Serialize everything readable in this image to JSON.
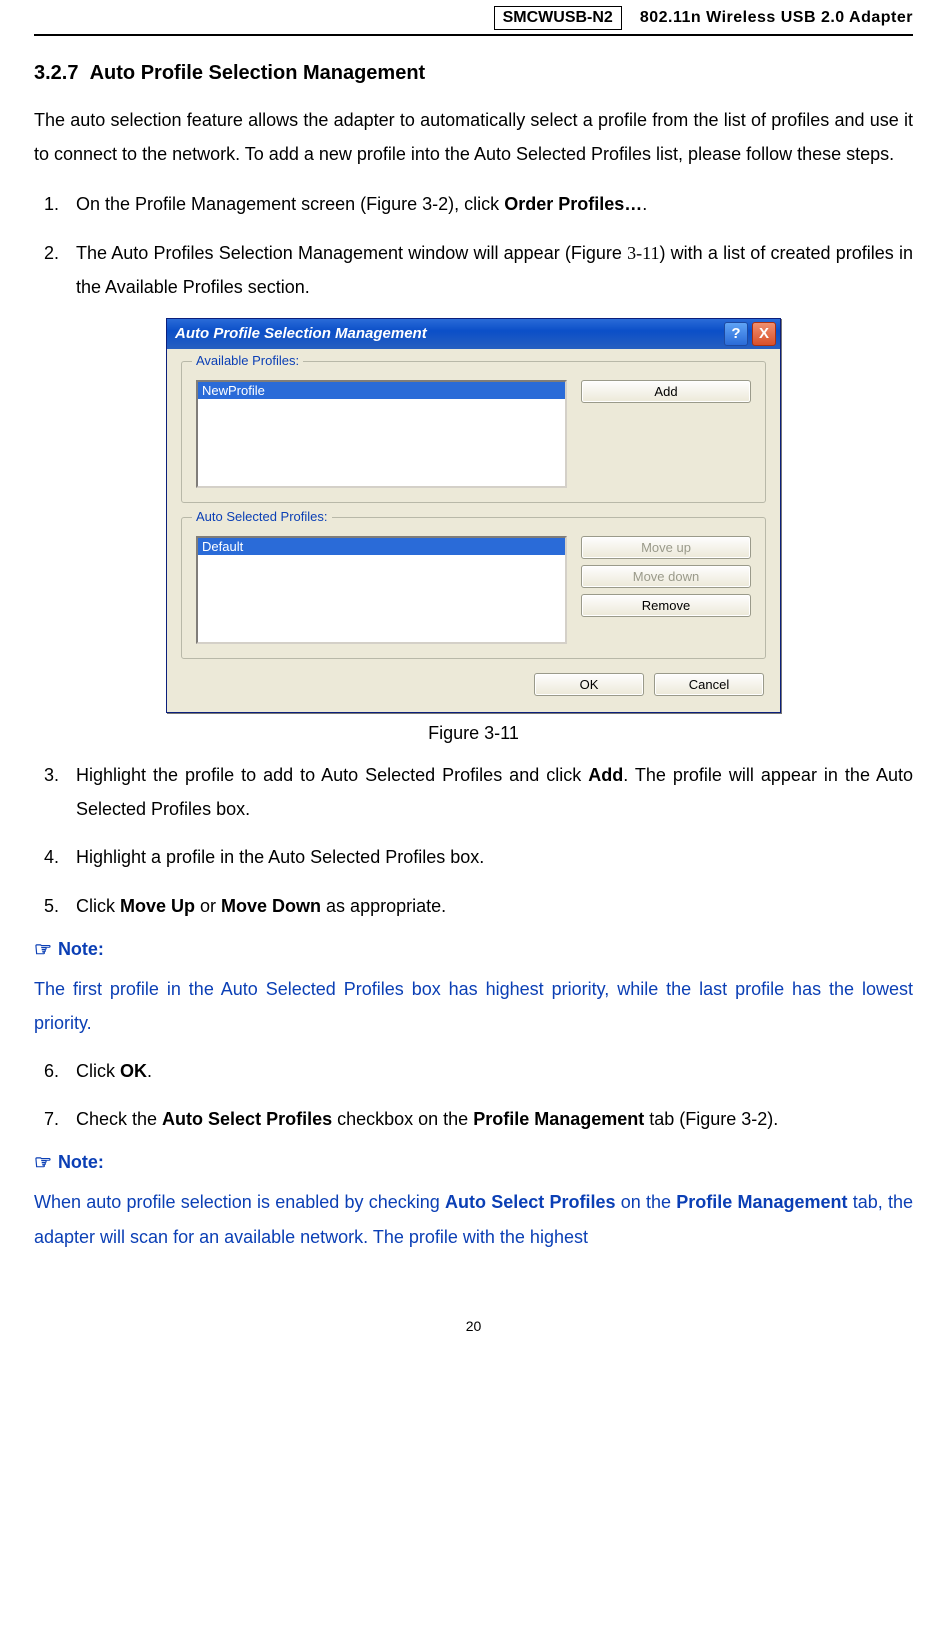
{
  "header": {
    "model": "SMCWUSB-N2",
    "product": "802.11n Wireless USB 2.0 Adapter"
  },
  "section": {
    "number": "3.2.7",
    "title": "Auto Profile Selection Management"
  },
  "intro": "The auto selection feature allows the adapter to automatically select a profile from the list of profiles and use it to connect to the network. To add a new profile into the Auto Selected Profiles list, please follow these steps.",
  "steps_part1": {
    "s1_pre": "On the Profile Management screen (Figure 3-2), click ",
    "s1_bold": "Order Profiles…",
    "s1_post": ".",
    "s2_pre": "The Auto Profiles Selection Management window will appear (Figure ",
    "s2_figref": "3-11",
    "s2_post": ") with a list of created profiles in the Available Profiles section."
  },
  "dialog": {
    "title": "Auto Profile Selection Management",
    "help": "?",
    "close": "X",
    "group1": {
      "title": "Available Profiles:",
      "items": [
        "NewProfile"
      ],
      "buttons": {
        "add": "Add"
      }
    },
    "group2": {
      "title": "Auto Selected Profiles:",
      "items": [
        "Default"
      ],
      "buttons": {
        "up": "Move up",
        "down": "Move down",
        "remove": "Remove"
      }
    },
    "footer": {
      "ok": "OK",
      "cancel": "Cancel"
    }
  },
  "figure_caption": "Figure 3-11",
  "steps_part2": {
    "s3_pre": "Highlight the profile to add to Auto Selected Profiles and click ",
    "s3_bold": "Add",
    "s3_post": ". The profile will appear in the Auto Selected Profiles box.",
    "s4": "Highlight a profile in the Auto Selected Profiles box.",
    "s5_pre": "Click ",
    "s5_b1": "Move Up",
    "s5_mid": " or ",
    "s5_b2": "Move Down",
    "s5_post": " as appropriate."
  },
  "note1": {
    "head": "Note:",
    "body": "The first profile in the Auto Selected Profiles box has highest priority, while the last profile has the lowest priority."
  },
  "steps_part3": {
    "s6_pre": "Click ",
    "s6_bold": "OK",
    "s6_post": ".",
    "s7_pre": "Check the ",
    "s7_b1": "Auto Select Profiles",
    "s7_mid": " checkbox on the ",
    "s7_b2": "Profile Management",
    "s7_post": " tab (Figure 3-2)."
  },
  "note2": {
    "head": "Note:",
    "body_pre": "When auto profile selection is enabled by checking ",
    "body_b1": "Auto Select Profiles",
    "body_mid": " on the ",
    "body_b2": "Profile Management",
    "body_post": " tab, the adapter will scan for an available network. The profile with the highest"
  },
  "pointing_hand": "☞",
  "page_number": "20"
}
